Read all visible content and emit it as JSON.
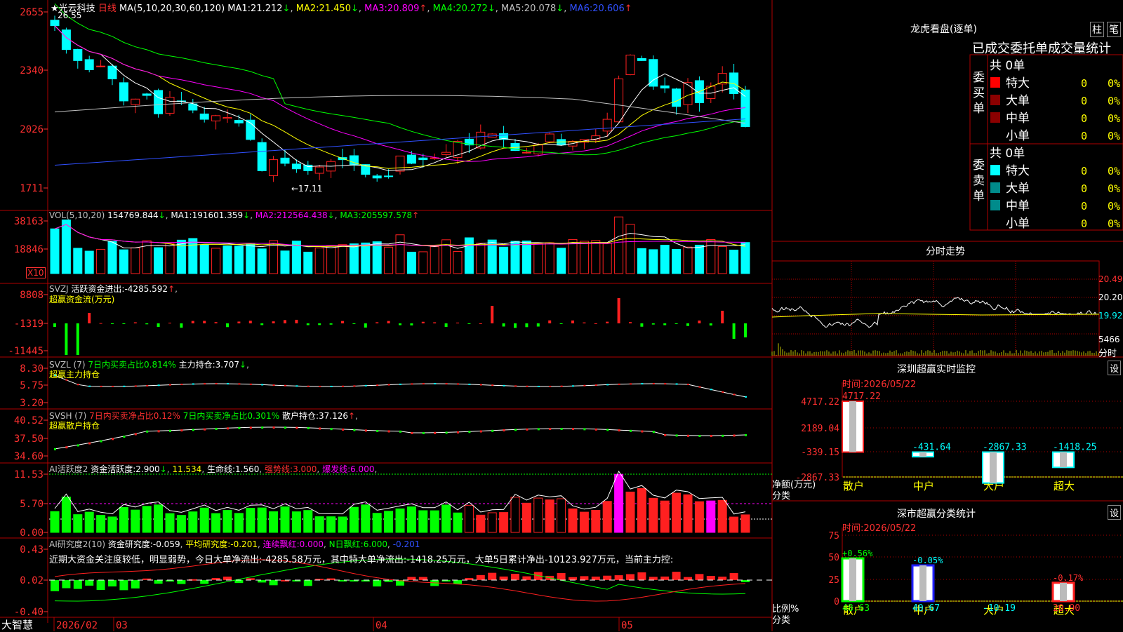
{
  "app": {
    "brand": "大智慧",
    "stock_name": "光云科技",
    "period_label": "日线",
    "date_axis": [
      "2026/02",
      "03",
      "04",
      "05"
    ]
  },
  "colors": {
    "bg": "#000000",
    "up": "#ff2020",
    "down": "#00ffff",
    "grid": "#b00000",
    "ma1": "#ffffff",
    "ma2": "#ffff00",
    "ma3": "#ff00ff",
    "ma4": "#00ff00",
    "ma5": "#c0c0c0",
    "ma6": "#2020ff"
  },
  "price_panel": {
    "ma_header": "MA(5,10,20,30,60,120)",
    "mas": [
      {
        "label": "MA1:",
        "value": "21.212",
        "arrow": "↓",
        "color": "#ffffff"
      },
      {
        "label": "MA2:",
        "value": "21.450",
        "arrow": "↓",
        "color": "#ffff00"
      },
      {
        "label": "MA3:",
        "value": "20.809",
        "arrow": "↑",
        "color": "#ff00ff"
      },
      {
        "label": "MA4:",
        "value": "20.272",
        "arrow": "↓",
        "color": "#00ff00"
      },
      {
        "label": "MA5:",
        "value": "20.078",
        "arrow": "↓",
        "color": "#c0c0c0"
      },
      {
        "label": "MA6:",
        "value": "20.606",
        "arrow": "↑",
        "color": "#2020ff"
      }
    ],
    "y_ticks": [
      "2655",
      "2340",
      "2026",
      "1711"
    ],
    "high_note": "26.55",
    "low_note": "←17.11"
  },
  "vol_panel": {
    "header": "VOL(5,10,20)",
    "value": "154769.844",
    "arrow": "↓",
    "mas": [
      {
        "label": "MA1:",
        "value": "191601.359",
        "arrow": "↓"
      },
      {
        "label": "MA2:",
        "value": "212564.438",
        "arrow": "↓"
      },
      {
        "label": "MA3:",
        "value": "205597.578",
        "arrow": "↑"
      }
    ],
    "y_ticks": [
      "38163",
      "18846"
    ],
    "unit": "X10"
  },
  "svzj_panel": {
    "header": "SVZJ",
    "label": "活跃资金进出:",
    "value": "-4285.592",
    "arrow": "↑",
    "sub": "超赢资金流(万元)",
    "y_ticks": [
      "8808",
      "-1319",
      "-11445"
    ]
  },
  "svzl_panel": {
    "header": "SVZL (7)",
    "t1": "7日内买卖占比0.814%",
    "t2": "主力持仓:",
    "v2": "3.707",
    "arrow": "↓",
    "sub": "超赢主力持仓",
    "y_ticks": [
      "8.30",
      "5.75",
      "3.20"
    ]
  },
  "svsh_panel": {
    "header": "SVSH (7)",
    "t1": "7日内买卖净占比0.12%",
    "t2": "7日内买卖净占比0.301%",
    "t3": "散户持仓:",
    "v3": "37.126",
    "arrow": "↑",
    "sub": "超赢散户持仓",
    "y_ticks": [
      "40.52",
      "37.50",
      "34.60"
    ]
  },
  "ai1_panel": {
    "header": "AI活跃度2",
    "t1": "资金活跃度:",
    "v1": "2.900",
    "a1": "↓",
    "v2": "11.534",
    "t3": "生命线:",
    "v3": "1.560",
    "t4": "强势线:",
    "v4": "3.000",
    "t5": "爆发线:",
    "v5": "6.000",
    "y_ticks": [
      "11.53",
      "5.70",
      "0.00"
    ]
  },
  "ai2_panel": {
    "header": "AI研究度2(10)",
    "t1": "资金研究度:",
    "v1": "-0.059",
    "t2": "平均研究度:",
    "v2": "-0.201",
    "t3": "连续飘红:",
    "v3": "0.000",
    "t4": "N日飘红:",
    "v4": "6.000",
    "v5": "-0.201",
    "text": "近期大资金关注度较低，明显弱势，今日大单净流出:-4285.58万元，其中特大单净流出:-1418.25万元，大单5日累计净出-10123.927万元，当前主力控:",
    "y_ticks": [
      "0.43",
      "0.02",
      "-0.40"
    ]
  },
  "lhb": {
    "title": "龙虎看盘(逐单)",
    "tab1": "柱",
    "tab2": "笔",
    "header": "已成交委托单成交量统计",
    "buy_title": "委买单",
    "sell_title": "委卖单",
    "total": "共 0单",
    "rows": [
      {
        "name": "特大",
        "count": "0",
        "pct": "0%"
      },
      {
        "name": "大单",
        "count": "0",
        "pct": "0%"
      },
      {
        "name": "中单",
        "count": "0",
        "pct": "0%"
      },
      {
        "name": "小单",
        "count": "0",
        "pct": "0%"
      }
    ],
    "buy_colors": [
      "#ff0000",
      "#8b0000",
      "#8b0000",
      "#000000"
    ],
    "sell_colors": [
      "#00ffff",
      "#008b8b",
      "#008b8b",
      "#000000"
    ]
  },
  "fenshi": {
    "title": "分时走势",
    "prices": [
      "20.49",
      "20.20",
      "19.92"
    ],
    "vol": "5466",
    "vol_label": "分时"
  },
  "sz_monitor": {
    "title": "深圳超赢实时监控",
    "btn": "设",
    "time_label": "时间:",
    "time": "2026/05/22",
    "y_ticks": [
      "4717.22",
      "2189.04",
      "-339.15",
      "-2867.33"
    ],
    "y_unit": "净额(万元)",
    "x_unit": "分类",
    "chart_data": {
      "type": "bar",
      "categories": [
        "散户",
        "中户",
        "大户",
        "超大"
      ],
      "values": [
        4717.22,
        -431.64,
        -2867.33,
        -1418.25
      ],
      "ylim": [
        -2867.33,
        4717.22
      ]
    }
  },
  "sz_class": {
    "title": "深市超赢分类统计",
    "btn": "设",
    "time_label": "时间:",
    "time": "2026/05/22",
    "y_ticks": [
      "75",
      "50",
      "25",
      "0"
    ],
    "y_unit": "比例%",
    "x_unit": "分类",
    "chart_data": {
      "type": "bar",
      "categories": [
        "散户",
        "中户",
        "大户",
        "超大"
      ],
      "values": [
        48.63,
        40.67,
        -10.19,
        20.9
      ],
      "changes": [
        "+0.56%",
        "-0.05%",
        "",
        "-0.17%"
      ],
      "ylim": [
        0,
        75
      ]
    }
  }
}
